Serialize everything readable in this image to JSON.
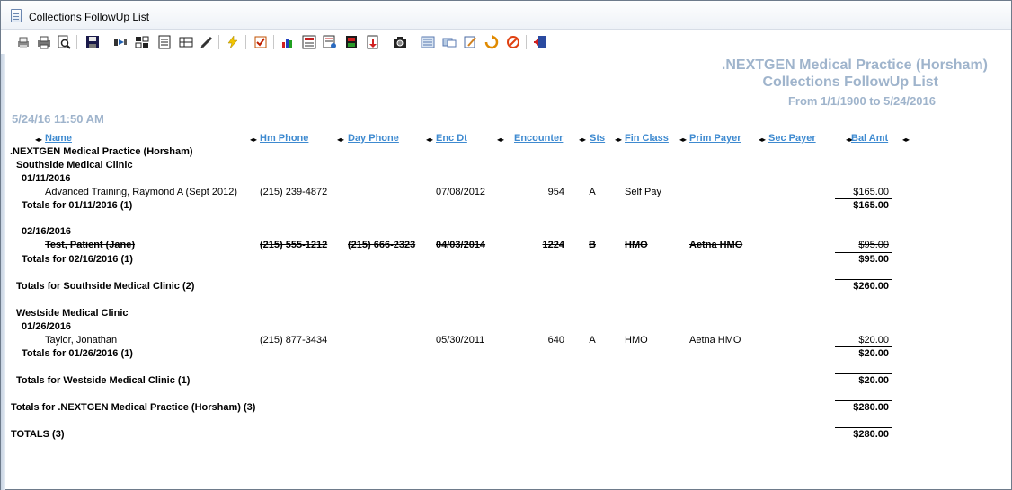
{
  "window": {
    "title": "Collections FollowUp List"
  },
  "toolbar": {
    "icons": [
      "print-setup-icon",
      "print-icon",
      "print-preview-icon",
      "save-icon",
      "export-icon",
      "barcode-icon",
      "form-icon",
      "columns-icon",
      "pen-icon",
      "lightning-icon",
      "checklist-icon",
      "bar-chart-icon",
      "report-chart-icon",
      "report-edit-icon",
      "book-icon",
      "export-doc-icon",
      "camera-icon",
      "list-icon",
      "message-icon",
      "note-edit-icon",
      "refresh-icon",
      "cancel-icon",
      "exit-icon"
    ]
  },
  "report": {
    "practice_header": ".NEXTGEN Medical Practice (Horsham)",
    "report_title": "Collections FollowUp List",
    "date_range": "From 1/1/1900 to 5/24/2016",
    "timestamp": "5/24/16 11:50 AM",
    "columns": {
      "name": "Name",
      "hm_phone": "Hm Phone",
      "day_phone": "Day Phone",
      "enc_dt": "Enc Dt",
      "encounter": "Encounter",
      "sts": "Sts",
      "fin_class": "Fin Class",
      "prim_payer": "Prim Payer",
      "sec_payer": "Sec Payer",
      "bal_amt": "Bal Amt"
    },
    "practice_group": ".NEXTGEN Medical Practice (Horsham)",
    "locations": [
      {
        "name": "Southside Medical Clinic",
        "dates": [
          {
            "date": "01/11/2016",
            "rows": [
              {
                "name": "Advanced Training, Raymond A (Sept 2012)",
                "hm_phone": "(215) 239-4872",
                "day_phone": "",
                "enc_dt": "07/08/2012",
                "encounter": "954",
                "sts": "A",
                "fin_class": "Self Pay",
                "prim_payer": "",
                "sec_payer": "",
                "bal_amt": "$165.00"
              }
            ],
            "total_label": "Totals for 01/11/2016 (1)",
            "total": "$165.00"
          },
          {
            "date": "02/16/2016",
            "rows": [
              {
                "name": "Test, Patient (Jane)",
                "hm_phone": "(215) 555-1212",
                "day_phone": "(215) 666-2323",
                "enc_dt": "04/03/2014",
                "encounter": "1224",
                "sts": "B",
                "fin_class": "HMO",
                "prim_payer": "Aetna HMO",
                "sec_payer": "",
                "bal_amt": "$95.00"
              }
            ],
            "total_label": "Totals for 02/16/2016 (1)",
            "total": "$95.00"
          }
        ],
        "total_label": "Totals for Southside Medical Clinic (2)",
        "total": "$260.00"
      },
      {
        "name": "Westside Medical Clinic",
        "dates": [
          {
            "date": "01/26/2016",
            "rows": [
              {
                "name": "Taylor, Jonathan",
                "hm_phone": "(215) 877-3434",
                "day_phone": "",
                "enc_dt": "05/30/2011",
                "encounter": "640",
                "sts": "A",
                "fin_class": "HMO",
                "prim_payer": "Aetna HMO",
                "sec_payer": "",
                "bal_amt": "$20.00"
              }
            ],
            "total_label": "Totals for 01/26/2016 (1)",
            "total": "$20.00"
          }
        ],
        "total_label": "Totals for Westside Medical Clinic (1)",
        "total": "$20.00"
      }
    ],
    "practice_total_label": "Totals for .NEXTGEN Medical Practice (Horsham) (3)",
    "practice_total": "$280.00",
    "grand_total_label": "TOTALS (3)",
    "grand_total": "$280.00"
  }
}
